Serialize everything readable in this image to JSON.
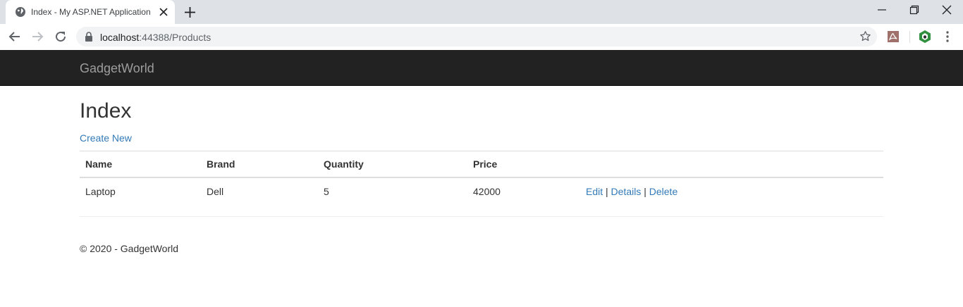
{
  "browser": {
    "tab_title": "Index - My ASP.NET Application",
    "url_host": "localhost",
    "url_port_path": ":44388/Products"
  },
  "app": {
    "brand": "GadgetWorld",
    "page_title": "Index",
    "create_new_label": "Create New",
    "table": {
      "headers": [
        "Name",
        "Brand",
        "Quantity",
        "Price"
      ],
      "rows": [
        {
          "name": "Laptop",
          "brand": "Dell",
          "quantity": "5",
          "price": "42000"
        }
      ],
      "actions": {
        "edit": "Edit",
        "details": "Details",
        "delete": "Delete",
        "separator": "|"
      }
    },
    "footer": "© 2020 - GadgetWorld"
  },
  "colors": {
    "navbar_bg": "#222222",
    "brand_text": "#9d9d9d",
    "link": "#337ab7",
    "text": "#333333"
  }
}
